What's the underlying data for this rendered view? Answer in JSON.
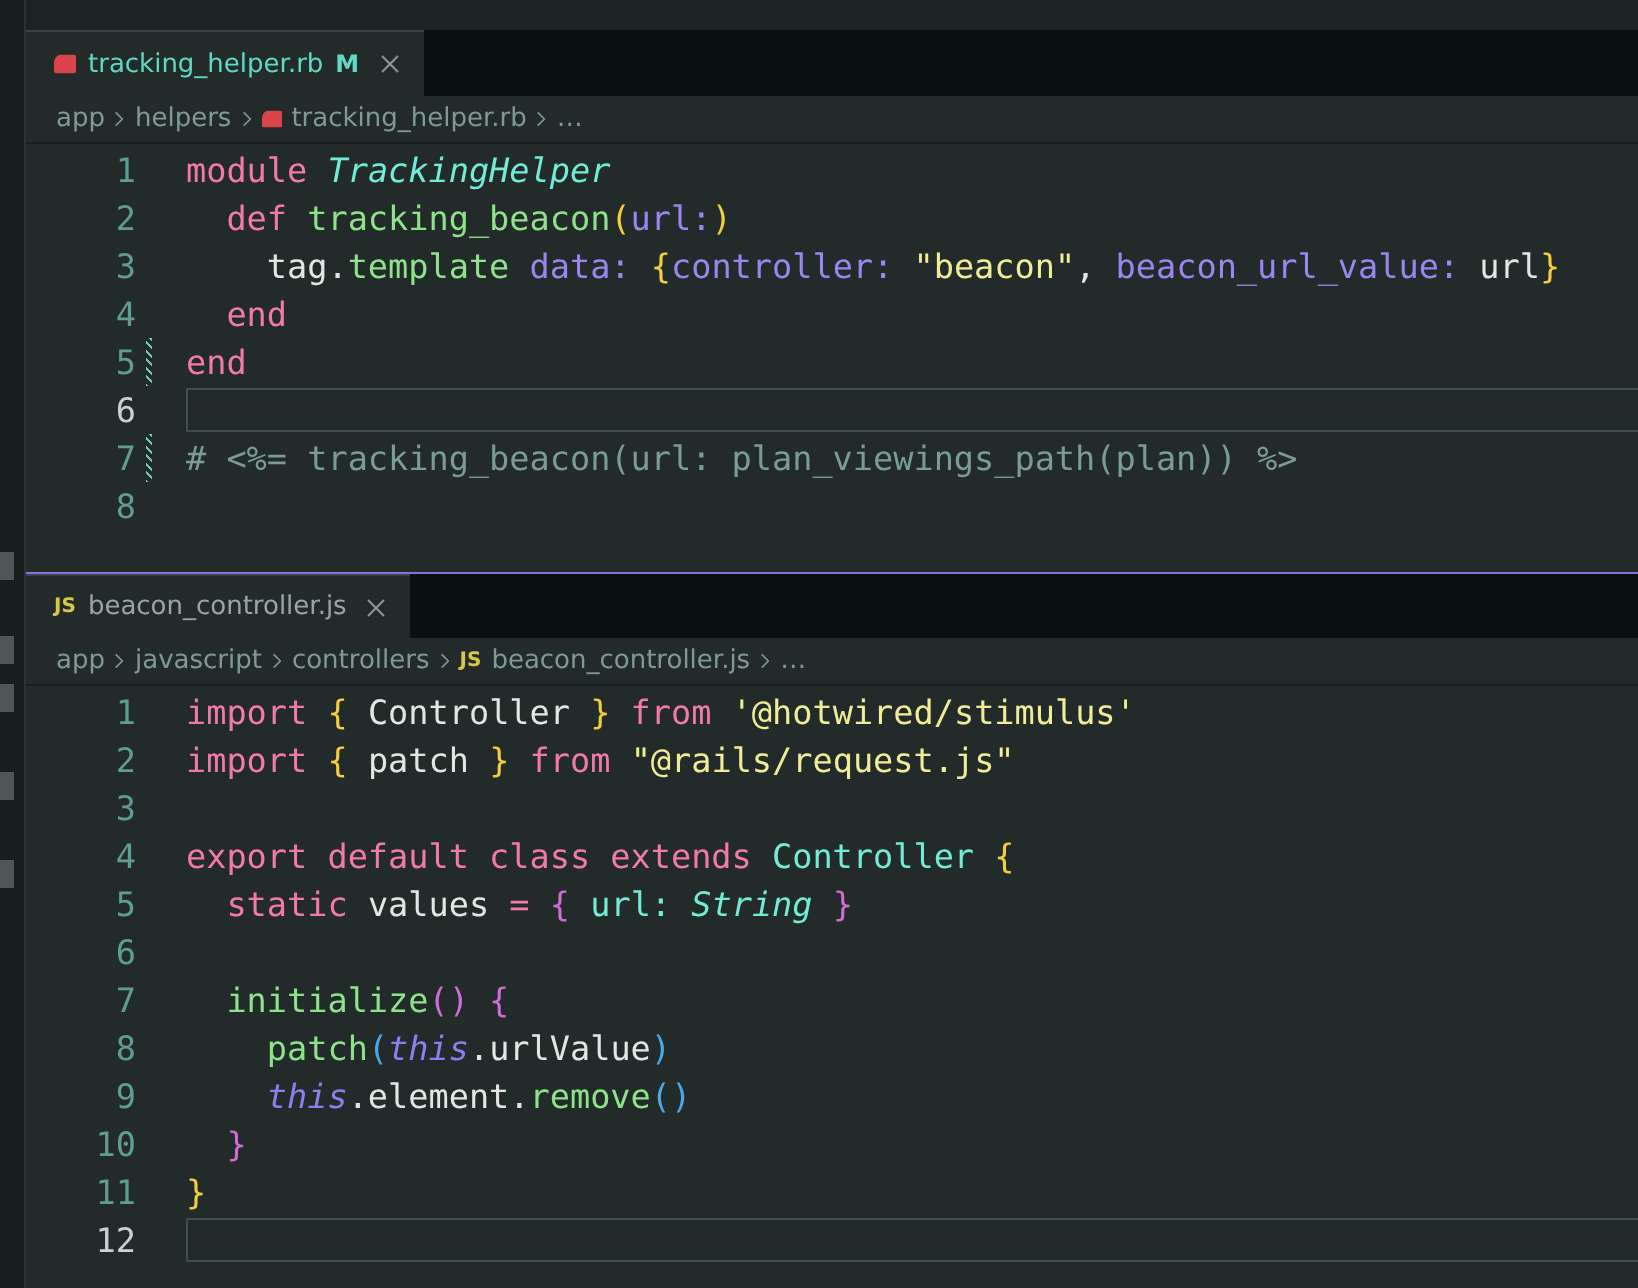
{
  "panes": [
    {
      "tab": {
        "label": "tracking_helper.rb",
        "kind": "ruby",
        "modified": true,
        "badge": "M"
      },
      "breadcrumbs": [
        {
          "label": "app"
        },
        {
          "label": "helpers"
        },
        {
          "label": "tracking_helper.rb",
          "kind": "ruby"
        },
        {
          "label": "…"
        }
      ],
      "lines": [
        {
          "number": "1",
          "current": false,
          "kind": "flat",
          "tokens": [
            {
              "kind": "keyword",
              "text": "module "
            },
            {
              "kind": "type",
              "text": "TrackingHelper"
            }
          ]
        },
        {
          "number": "2",
          "current": false,
          "kind": "indent",
          "tokens": [
            {
              "kind": "keyword",
              "text": "def "
            },
            {
              "kind": "function",
              "text": "tracking_beacon"
            },
            {
              "kind": "brace",
              "text": "("
            },
            {
              "kind": "param",
              "text": "url:"
            },
            {
              "kind": "brace",
              "text": ")"
            }
          ]
        },
        {
          "number": "3",
          "current": false,
          "kind": "deep",
          "tokens": [
            {
              "kind": "plain",
              "text": "tag."
            },
            {
              "kind": "function",
              "text": "template"
            },
            {
              "kind": "param",
              "text": " data: "
            },
            {
              "kind": "brace",
              "text": "{"
            },
            {
              "kind": "param",
              "text": "controller: "
            },
            {
              "kind": "string",
              "text": "\"beacon\""
            },
            {
              "kind": "plain",
              "text": ", "
            },
            {
              "kind": "param",
              "text": "beacon_url_value: "
            },
            {
              "kind": "plain",
              "text": "url"
            },
            {
              "kind": "brace",
              "text": "}"
            }
          ]
        },
        {
          "number": "4",
          "current": false,
          "kind": "indent",
          "tokens": [
            {
              "kind": "keyword",
              "text": "end"
            }
          ]
        },
        {
          "number": "5",
          "current": false,
          "changed": true,
          "kind": "flat",
          "tokens": [
            {
              "kind": "keyword",
              "text": "end"
            }
          ]
        },
        {
          "number": "6",
          "current": true
        },
        {
          "number": "7",
          "current": false,
          "changed": true,
          "kind": "flat",
          "tokens": [
            {
              "kind": "comment",
              "text": "# <%= tracking_beacon(url: plan_viewings_path(plan)) %>"
            }
          ]
        },
        {
          "number": "8",
          "current": false
        }
      ]
    },
    {
      "tab": {
        "label": "beacon_controller.js",
        "kind": "js",
        "icon_text": "JS",
        "modified": false
      },
      "breadcrumbs": [
        {
          "label": "app"
        },
        {
          "label": "javascript"
        },
        {
          "label": "controllers"
        },
        {
          "label": "beacon_controller.js",
          "kind": "js",
          "icon_text": "JS"
        },
        {
          "label": "…"
        }
      ],
      "lines": [
        {
          "number": "1",
          "current": false,
          "kind": "flat",
          "tokens": [
            {
              "kind": "keyword",
              "text": "import "
            },
            {
              "kind": "brace",
              "text": "{"
            },
            {
              "kind": "plain",
              "text": " Controller "
            },
            {
              "kind": "brace",
              "text": "}"
            },
            {
              "kind": "keyword",
              "text": " from "
            },
            {
              "kind": "string",
              "text": "'@hotwired/stimulus'"
            }
          ]
        },
        {
          "number": "2",
          "current": false,
          "kind": "flat",
          "tokens": [
            {
              "kind": "keyword",
              "text": "import "
            },
            {
              "kind": "brace",
              "text": "{"
            },
            {
              "kind": "plain",
              "text": " patch "
            },
            {
              "kind": "brace",
              "text": "}"
            },
            {
              "kind": "keyword",
              "text": " from "
            },
            {
              "kind": "string",
              "text": "\"@rails/request.js\""
            }
          ]
        },
        {
          "number": "3",
          "current": false
        },
        {
          "number": "4",
          "current": false,
          "kind": "flat",
          "tokens": [
            {
              "kind": "keyword",
              "text": "export default class extends "
            },
            {
              "kind": "class",
              "text": "Controller "
            },
            {
              "kind": "brace",
              "text": "{"
            }
          ]
        },
        {
          "number": "5",
          "current": false,
          "kind": "indent",
          "tokens": [
            {
              "kind": "keyword",
              "text": "static "
            },
            {
              "kind": "plain",
              "text": "values "
            },
            {
              "kind": "keyword",
              "text": "= "
            },
            {
              "kind": "bracket",
              "text": "{ "
            },
            {
              "kind": "class",
              "text": "url: "
            },
            {
              "kind": "type",
              "text": "String "
            },
            {
              "kind": "bracket",
              "text": "}"
            }
          ]
        },
        {
          "number": "6",
          "current": false
        },
        {
          "number": "7",
          "current": false,
          "kind": "indent",
          "tokens": [
            {
              "kind": "function",
              "text": "initialize"
            },
            {
              "kind": "bracket",
              "text": "() {"
            }
          ]
        },
        {
          "number": "8",
          "current": false,
          "kind": "deep",
          "tokens": [
            {
              "kind": "function",
              "text": "patch"
            },
            {
              "kind": "paren",
              "text": "("
            },
            {
              "kind": "this",
              "text": "this"
            },
            {
              "kind": "plain",
              "text": ".urlValue"
            },
            {
              "kind": "paren",
              "text": ")"
            }
          ]
        },
        {
          "number": "9",
          "current": false,
          "kind": "deep",
          "tokens": [
            {
              "kind": "this",
              "text": "this"
            },
            {
              "kind": "plain",
              "text": ".element."
            },
            {
              "kind": "function",
              "text": "remove"
            },
            {
              "kind": "paren",
              "text": "()"
            }
          ]
        },
        {
          "number": "10",
          "current": false,
          "kind": "indent",
          "tokens": [
            {
              "kind": "bracket",
              "text": "}"
            }
          ]
        },
        {
          "number": "11",
          "current": false,
          "kind": "flat",
          "tokens": [
            {
              "kind": "brace",
              "text": "}"
            }
          ]
        },
        {
          "number": "12",
          "current": true
        }
      ]
    }
  ]
}
